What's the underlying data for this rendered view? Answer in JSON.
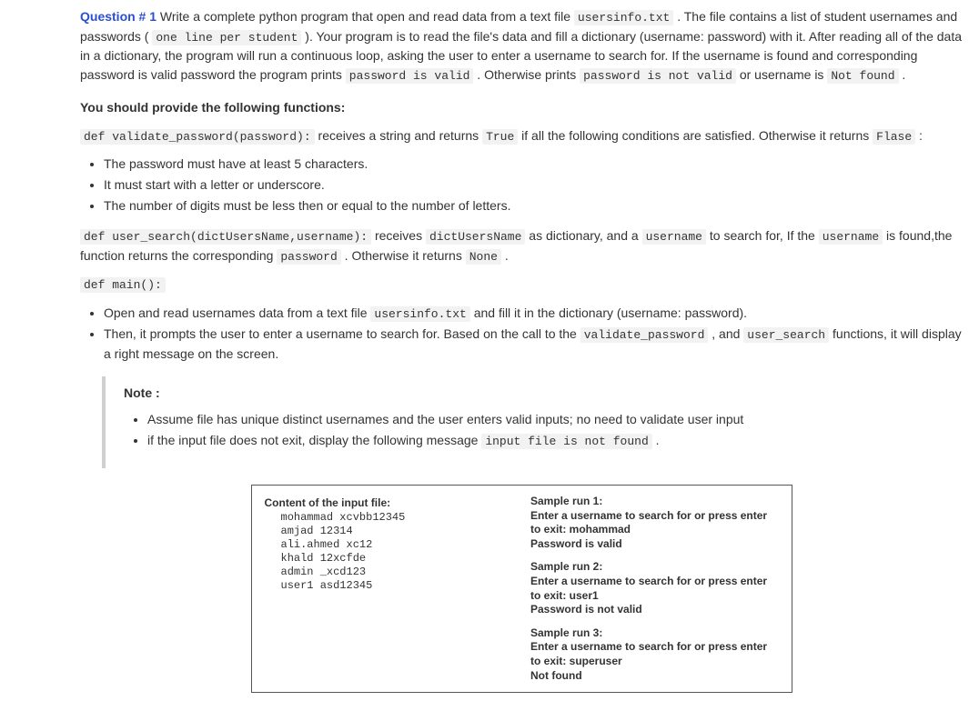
{
  "question": {
    "label": "Question # 1",
    "p1_a": " Write a complete python program that open and read data from a text file ",
    "c1": "usersinfo.txt",
    "p1_b": " . The file contains a list of student usernames and passwords ( ",
    "c2": "one line per student",
    "p1_c": " ). Your program is to read the file's data and fill a dictionary (username: password) with it. After reading all of the data in a dictionary, the program will run a continuous loop, asking the user to enter a username to search for. If the username is found and corresponding password is valid password the program prints ",
    "c3": "password is valid",
    "p1_d": " . Otherwise prints ",
    "c4": "password is not valid",
    "p1_e": " or username is ",
    "c5": "Not found",
    "p1_f": " ."
  },
  "provide_heading": "You should provide the following functions:",
  "fn1": {
    "sig": "def validate_password(password):",
    "desc_a": " receives a string and returns ",
    "c_true": "True",
    "desc_b": " if all the following conditions are satisfied. Otherwise it returns ",
    "c_false": "Flase",
    "desc_c": " :"
  },
  "rules": {
    "r1": "The password must have at least 5 characters.",
    "r2": "It must start with a letter or underscore.",
    "r3": "The number of digits must be less then or equal to the number of letters."
  },
  "fn2": {
    "sig": "def user_search(dictUsersName,username):",
    "a": " receives ",
    "c_dict": "dictUsersName",
    "b": " as dictionary, and a ",
    "c_user": "username",
    "c": " to search for, If the ",
    "c_user2": "username",
    "d": " is found,the function returns the corresponding ",
    "c_pwd": "password",
    "e": " . Otherwise it returns ",
    "c_none": "None",
    "f": " ."
  },
  "fn3": {
    "sig": "def main():"
  },
  "main_items": {
    "m1a": "Open and read usernames data from a text file ",
    "m1c": "usersinfo.txt",
    "m1b": " and fill it in the dictionary (username: password).",
    "m2a": "Then, it prompts the user to enter a username to search for. Based on the call to the ",
    "m2c1": "validate_password",
    "m2b": " , and ",
    "m2c2": "user_search",
    "m2c": " functions, it will display a right message on the screen."
  },
  "note": {
    "title": "Note :",
    "n1": "Assume file has unique distinct usernames and the user enters valid inputs; no need to validate user input",
    "n2a": "if the input file does not exit, display the following message ",
    "n2c": "input file is not found",
    "n2b": " ."
  },
  "sample": {
    "content_hdr": "Content of the input file:",
    "file_lines": "mohammad xcvbb12345\namjad 12314\nali.ahmed xc12\nkhald 12xcfde\nadmin _xcd123\nuser1 asd12345",
    "run1_t": "Sample run 1:",
    "run1_l1": "Enter a username to search for or press enter to exit: mohammad",
    "run1_l2": "Password is valid",
    "run2_t": "Sample run 2:",
    "run2_l1": "Enter a username to search for or press enter to exit: user1",
    "run2_l2": "Password is not valid",
    "run3_t": "Sample run 3:",
    "run3_l1": "Enter a username to search for or press enter to exit: superuser",
    "run3_l2": "Not found"
  }
}
